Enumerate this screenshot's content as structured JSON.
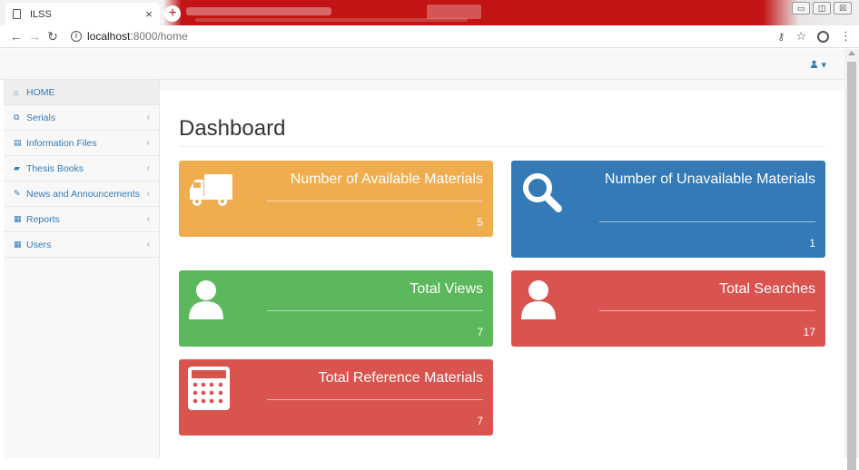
{
  "browser": {
    "tab_title": "ILSS",
    "tab_close": "×",
    "new_tab": "+",
    "url_host": "localhost",
    "url_path": ":8000/home",
    "window_controls": [
      "▭",
      "◫",
      "☒"
    ]
  },
  "topnav": {
    "user_icon": "user-icon",
    "user_caret": "▾"
  },
  "sidebar": {
    "items": [
      {
        "icon": "home-icon",
        "glyph": "⌂",
        "label": "HOME",
        "chevron": ""
      },
      {
        "icon": "copy-icon",
        "glyph": "⧉",
        "label": "Serials",
        "chevron": "‹"
      },
      {
        "icon": "file-icon",
        "glyph": "▤",
        "label": "Information Files",
        "chevron": "‹"
      },
      {
        "icon": "book-icon",
        "glyph": "▰",
        "label": "Thesis Books",
        "chevron": "‹"
      },
      {
        "icon": "edit-icon",
        "glyph": "✎",
        "label": "News and Announcements",
        "chevron": "‹"
      },
      {
        "icon": "table-icon",
        "glyph": "▦",
        "label": "Reports",
        "chevron": "‹"
      },
      {
        "icon": "table-icon",
        "glyph": "▦",
        "label": "Users",
        "chevron": "‹"
      }
    ]
  },
  "main": {
    "title": "Dashboard",
    "cards": {
      "available": {
        "title": "Number of Available Materials",
        "value": "5",
        "color": "#f0ad4e",
        "icon": "truck-icon"
      },
      "unavailable": {
        "title": "Number of Unavailable Materials",
        "value": "1",
        "color": "#337ab7",
        "icon": "search-icon"
      },
      "views": {
        "title": "Total Views",
        "value": "7",
        "color": "#5cb85c",
        "icon": "user-icon"
      },
      "searches": {
        "title": "Total Searches",
        "value": "17",
        "color": "#d9534f",
        "icon": "user-icon"
      },
      "reference": {
        "title": "Total Reference Materials",
        "value": "7",
        "color": "#d9534f",
        "icon": "calculator-icon"
      }
    }
  }
}
